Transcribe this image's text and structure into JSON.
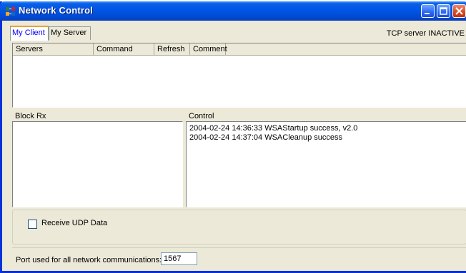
{
  "window": {
    "title": "Network Control",
    "icons": {
      "app": "network-app-icon",
      "minimize": "minimize-icon",
      "maximize": "maximize-icon",
      "close": "close-icon"
    },
    "colors": {
      "titlebar": "#0054e3",
      "close": "#d9471e",
      "face": "#ece9d8"
    }
  },
  "tabs": [
    {
      "label": "My Client",
      "active": true
    },
    {
      "label": "My Server",
      "active": false
    }
  ],
  "server_status": "TCP server INACTIVE",
  "servers_list": {
    "columns": [
      "Servers",
      "Command",
      "Refresh",
      "Comment"
    ]
  },
  "block_rx": {
    "label": "Block Rx"
  },
  "control": {
    "label": "Control",
    "lines": [
      "2004-02-24 14:36:33  WSAStartup success, v2.0",
      "2004-02-24 14:37:04  WSACleanup success"
    ]
  },
  "udp": {
    "label": "Receive UDP Data",
    "checked": false
  },
  "port": {
    "label": "Port used for all network communications:",
    "value": "1567"
  }
}
